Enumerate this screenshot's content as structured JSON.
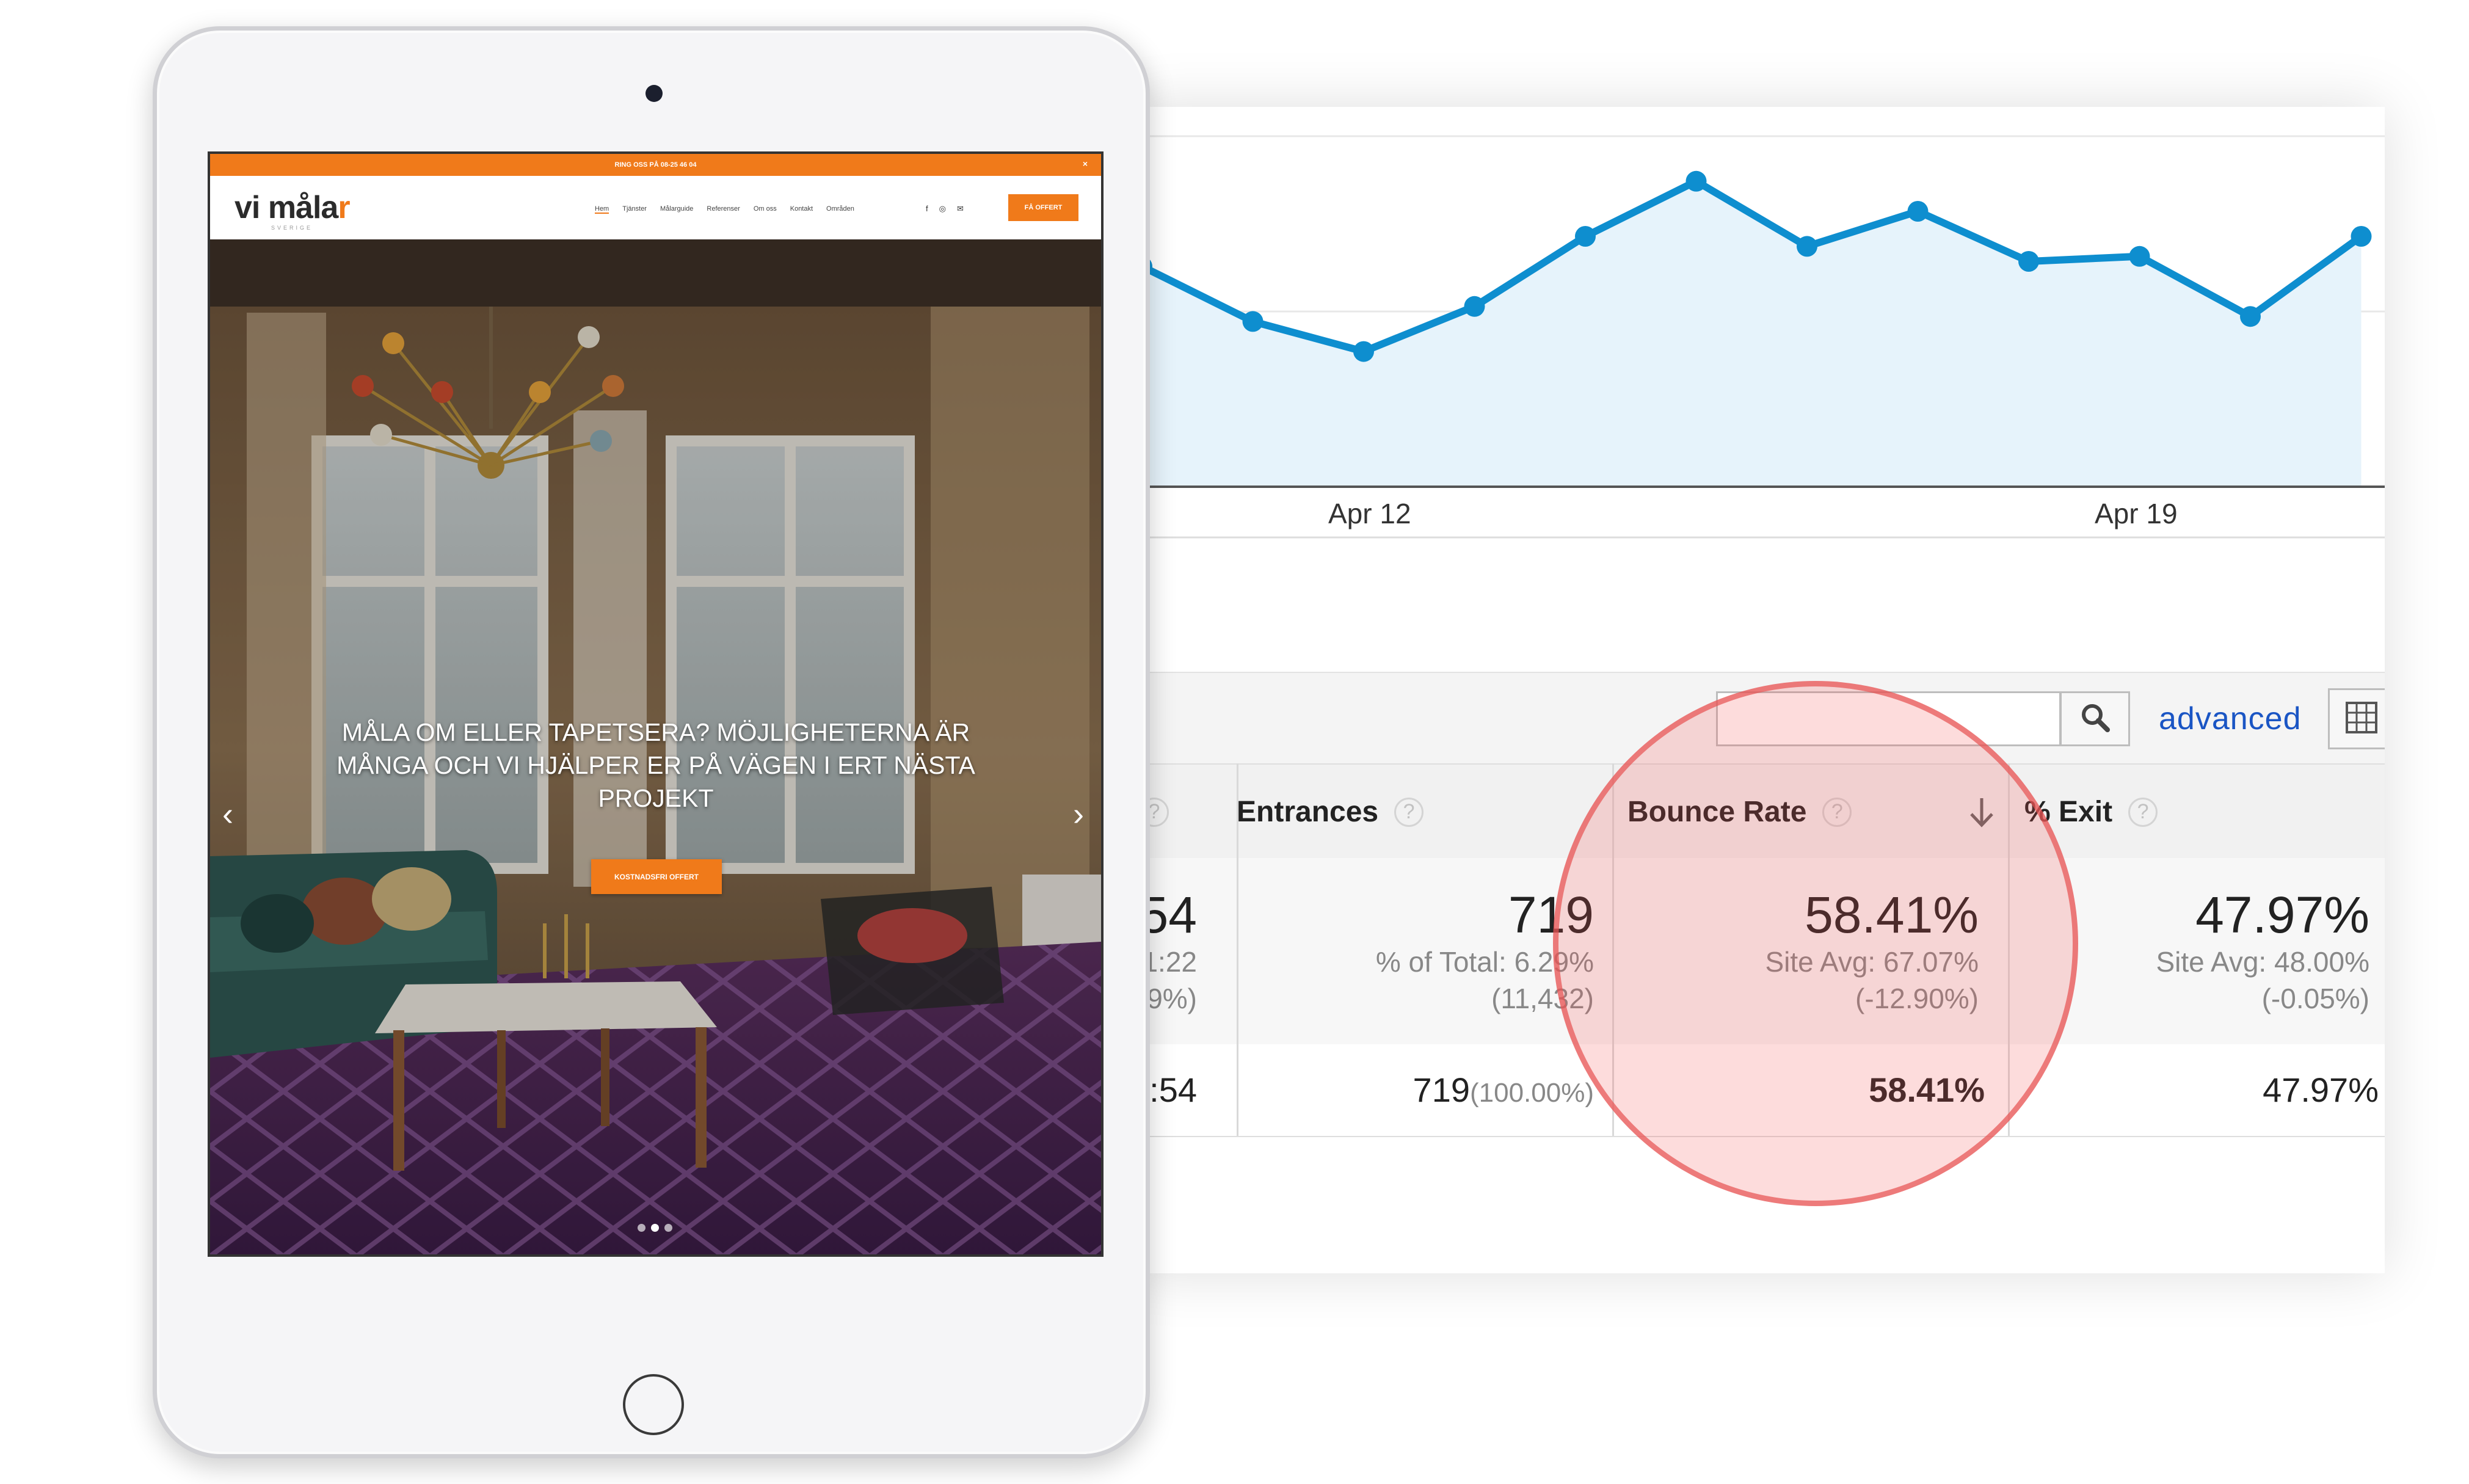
{
  "analytics": {
    "chart_data": {
      "type": "area",
      "x_tick_labels": [
        "Apr 12",
        "Apr 19"
      ],
      "values": [
        56,
        45,
        39,
        48,
        62,
        73,
        60,
        67,
        57,
        58,
        46,
        62
      ],
      "ylim": [
        12,
        82
      ],
      "line_color": "#0e8ecf",
      "fill_color": "#e6f3fb"
    },
    "filter": {
      "placeholder": "",
      "search_icon": "search-icon",
      "advanced_label": "advanced",
      "grid_icon": "table-view-icon"
    },
    "table": {
      "headers": [
        "",
        "Entrances",
        "Bounce Rate",
        "% Exit"
      ],
      "sort_icon": "arrow-down-icon",
      "summary": {
        "prev_col": {
          "main": ":54",
          "line1": "01:22",
          "line2": "59%)"
        },
        "entrances": {
          "main": "719",
          "line1": "% of Total: 6.29%",
          "line2": "(11,432)"
        },
        "bounce_rate": {
          "main": "58.41%",
          "line1": "Site Avg: 67.07%",
          "line2": "(-12.90%)"
        },
        "exit": {
          "main": "47.97%",
          "line1": "Site Avg: 48.00%",
          "line2": "(-0.05%)"
        }
      },
      "row": {
        "prev_col": "01:54",
        "entrances": "719",
        "entrances_pct": "(100.00%)",
        "bounce_rate": "58.41%",
        "exit": "47.97%"
      }
    }
  },
  "ipad": {
    "topbar_text": "RING OSS PÅ 08-25 46 04",
    "topbar_close": "×",
    "logo_text": "vi måla",
    "logo_accent": "r",
    "logo_sub": "SVERIGE",
    "nav": [
      "Hem",
      "Tjänster",
      "Målarguide",
      "Referenser",
      "Om oss",
      "Kontakt",
      "Områden"
    ],
    "social": [
      "f",
      "◎",
      "✉"
    ],
    "cta_top": "FÅ OFFERT",
    "hero_title": "MÅLA OM ELLER TAPETSERA? MÖJLIGHETERNA ÄR MÅNGA OCH VI HJÄLPER ER PÅ VÄGEN I ERT NÄSTA PROJEKT",
    "hero_button": "KOSTNADSFRI OFFERT",
    "arrow_left": "‹",
    "arrow_right": "›",
    "slide_count": 3,
    "active_slide": 2,
    "brand_color": "#f07a1a"
  }
}
